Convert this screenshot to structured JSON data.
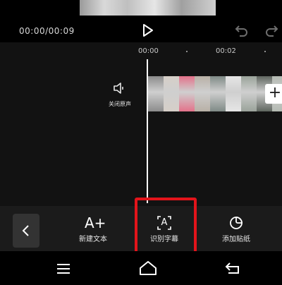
{
  "playback": {
    "time": "00:00/00:09"
  },
  "timeline": {
    "ruler_labels": [
      "00:00",
      "00:02"
    ],
    "mute_label": "关闭原声"
  },
  "video_track": {
    "frame_colors": [
      "#8c8c8c",
      "#d6cfc8",
      "#e3728a",
      "#b8b0a6",
      "#7f8a86",
      "#e6e6e6",
      "#9aa39a",
      "#5f665f",
      "#b4bab2"
    ]
  },
  "toolbar": {
    "new_text_label": "新建文本",
    "new_text_icon": "A+",
    "recognize_label": "识别字幕",
    "recognize_icon": "A",
    "sticker_label": "添加贴纸"
  },
  "colors": {
    "highlight": "#e3141b",
    "background": "#000000",
    "timeline_bg": "#121212",
    "toolbar_bg": "#1b1b1b"
  }
}
